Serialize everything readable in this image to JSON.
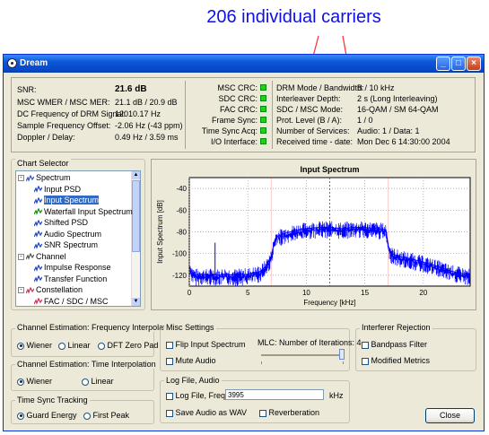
{
  "annotation": "206 individual carriers",
  "window": {
    "title": "Dream"
  },
  "measures": {
    "snr_label": "SNR:",
    "snr_value": "21.6 dB",
    "mer_label": "MSC WMER / MSC MER:",
    "mer_value": "21.1 dB / 20.9 dB",
    "dcfreq_label": "DC Frequency of DRM Signal:",
    "dcfreq_value": "12010.17 Hz",
    "offset_label": "Sample Frequency Offset:",
    "offset_value": "-2.06 Hz (-43 ppm)",
    "doppler_label": "Doppler / Delay:",
    "doppler_value": "0.49 Hz / 3.59 ms"
  },
  "status": {
    "items": [
      "MSC CRC:",
      "SDC CRC:",
      "FAC CRC:",
      "Frame Sync:",
      "Time Sync Acq:",
      "I/O Interface:"
    ],
    "led_color": "#19d419"
  },
  "drm": {
    "labels": [
      "DRM Mode / Bandwidth:",
      "Interleaver Depth:",
      "SDC / MSC Mode:",
      "Prot. Level (B / A):",
      "Number of Services:",
      "Received time - date:"
    ],
    "values": [
      "B / 10 kHz",
      "2 s (Long Interleaving)",
      "16-QAM / SM 64-QAM",
      "1 / 0",
      "Audio: 1 / Data: 1",
      "Mon Dec 6 14:30:00 2004"
    ]
  },
  "chart_selector": {
    "title": "Chart Selector",
    "items": [
      {
        "label": "Spectrum",
        "level": 0,
        "icon": "spectrum-group-icon",
        "expander": "-"
      },
      {
        "label": "Input PSD",
        "level": 1,
        "icon": "psd-icon"
      },
      {
        "label": "Input Spectrum",
        "level": 1,
        "icon": "spectrum-icon",
        "selected": true
      },
      {
        "label": "Waterfall Input Spectrum",
        "level": 1,
        "icon": "waterfall-icon"
      },
      {
        "label": "Shifted PSD",
        "level": 1,
        "icon": "psd-icon"
      },
      {
        "label": "Audio Spectrum",
        "level": 1,
        "icon": "audio-icon"
      },
      {
        "label": "SNR Spectrum",
        "level": 1,
        "icon": "snr-icon"
      },
      {
        "label": "Channel",
        "level": 0,
        "icon": "channel-group-icon",
        "expander": "-"
      },
      {
        "label": "Impulse Response",
        "level": 1,
        "icon": "impulse-icon"
      },
      {
        "label": "Transfer Function",
        "level": 1,
        "icon": "transfer-icon"
      },
      {
        "label": "Constellation",
        "level": 0,
        "icon": "constellation-group-icon",
        "expander": "-"
      },
      {
        "label": "FAC / SDC / MSC",
        "level": 1,
        "icon": "constellation-icon"
      }
    ]
  },
  "chart_data": {
    "type": "line",
    "title": "Input Spectrum",
    "xlabel": "Frequency [kHz]",
    "ylabel": "Input Spectrum [dB]",
    "xlim": [
      0,
      24
    ],
    "ylim": [
      -130,
      -30
    ],
    "xticks": [
      0,
      5,
      10,
      15,
      20
    ],
    "yticks": [
      -40,
      -60,
      -80,
      -100,
      -120
    ],
    "grid": true,
    "series": [
      {
        "color": "#0000ff",
        "x": [
          0,
          0.3,
          0.6,
          1,
          1.5,
          2,
          2.5,
          3,
          4,
          5,
          6,
          6.5,
          7,
          7.2,
          7.4,
          8,
          9,
          10,
          11,
          12,
          13,
          14,
          15,
          16,
          16.8,
          17,
          17.3,
          18,
          19,
          20,
          21,
          22,
          23,
          24
        ],
        "y": [
          -112,
          -118,
          -120,
          -119,
          -120,
          -119,
          -120,
          -119,
          -120,
          -119,
          -117,
          -112,
          -103,
          -92,
          -85,
          -82,
          -79,
          -77,
          -76,
          -76,
          -77,
          -76,
          -76,
          -77,
          -78,
          -93,
          -100,
          -103,
          -105,
          -108,
          -111,
          -115,
          -118,
          -120
        ]
      }
    ],
    "markers": [
      {
        "x": 12.0,
        "color": "#ff0000"
      },
      {
        "x": 7.0,
        "color": "#ff0000"
      },
      {
        "x": 17.0,
        "color": "#ff0000"
      }
    ]
  },
  "freq_interp": {
    "title": "Channel Estimation: Frequency Interpolation",
    "options": [
      "Wiener",
      "Linear",
      "DFT Zero Pad"
    ],
    "selected": 0
  },
  "time_interp": {
    "title": "Channel Estimation: Time Interpolation",
    "options": [
      "Wiener",
      "Linear"
    ],
    "selected": 0
  },
  "time_sync": {
    "title": "Time Sync Tracking",
    "options": [
      "Guard Energy",
      "First Peak"
    ],
    "selected": 0
  },
  "misc": {
    "title": "Misc Settings",
    "flip": "Flip Input Spectrum",
    "mute": "Mute Audio",
    "mlc_label": "MLC: Number of Iterations: 4"
  },
  "logfile": {
    "title": "Log File, Audio",
    "log_label": "Log File, Freq:",
    "freq_value": "3995",
    "unit": "kHz",
    "save_wav": "Save Audio as WAV",
    "reverb": "Reverberation"
  },
  "interferer": {
    "title": "Interferer Rejection",
    "bandpass": "Bandpass Filter",
    "modified": "Modified Metrics"
  },
  "close_label": "Close"
}
